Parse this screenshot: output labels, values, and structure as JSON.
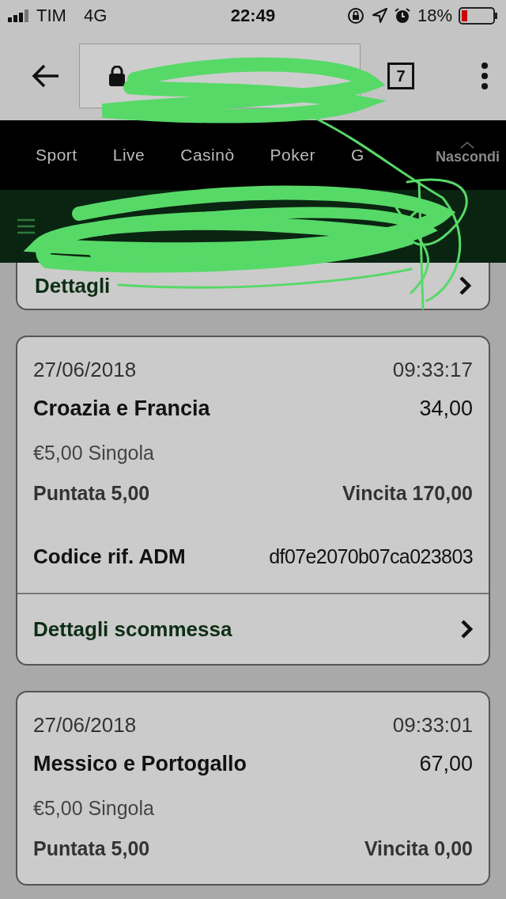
{
  "status_bar": {
    "carrier": "TIM",
    "network": "4G",
    "time": "22:49",
    "battery": "18%"
  },
  "browser": {
    "tab_count": "7"
  },
  "nav": {
    "items": [
      "Sport",
      "Live",
      "Casinò",
      "Poker",
      "G"
    ],
    "hide": "Nascondi"
  },
  "partial_card": {
    "details": "Dettagli"
  },
  "bets": [
    {
      "date": "27/06/2018",
      "time": "09:33:17",
      "match": "Croazia e Francia",
      "odds": "34,00",
      "type": "€5,00 Singola",
      "stake": "Puntata 5,00",
      "win": "Vincita 170,00",
      "code_label": "Codice rif. ADM",
      "code": "df07e2070b07ca023803",
      "details": "Dettagli scommessa"
    },
    {
      "date": "27/06/2018",
      "time": "09:33:01",
      "match": "Messico e Portogallo",
      "odds": "67,00",
      "type": "€5,00 Singola",
      "stake": "Puntata 5,00",
      "win": "Vincita 0,00"
    }
  ]
}
